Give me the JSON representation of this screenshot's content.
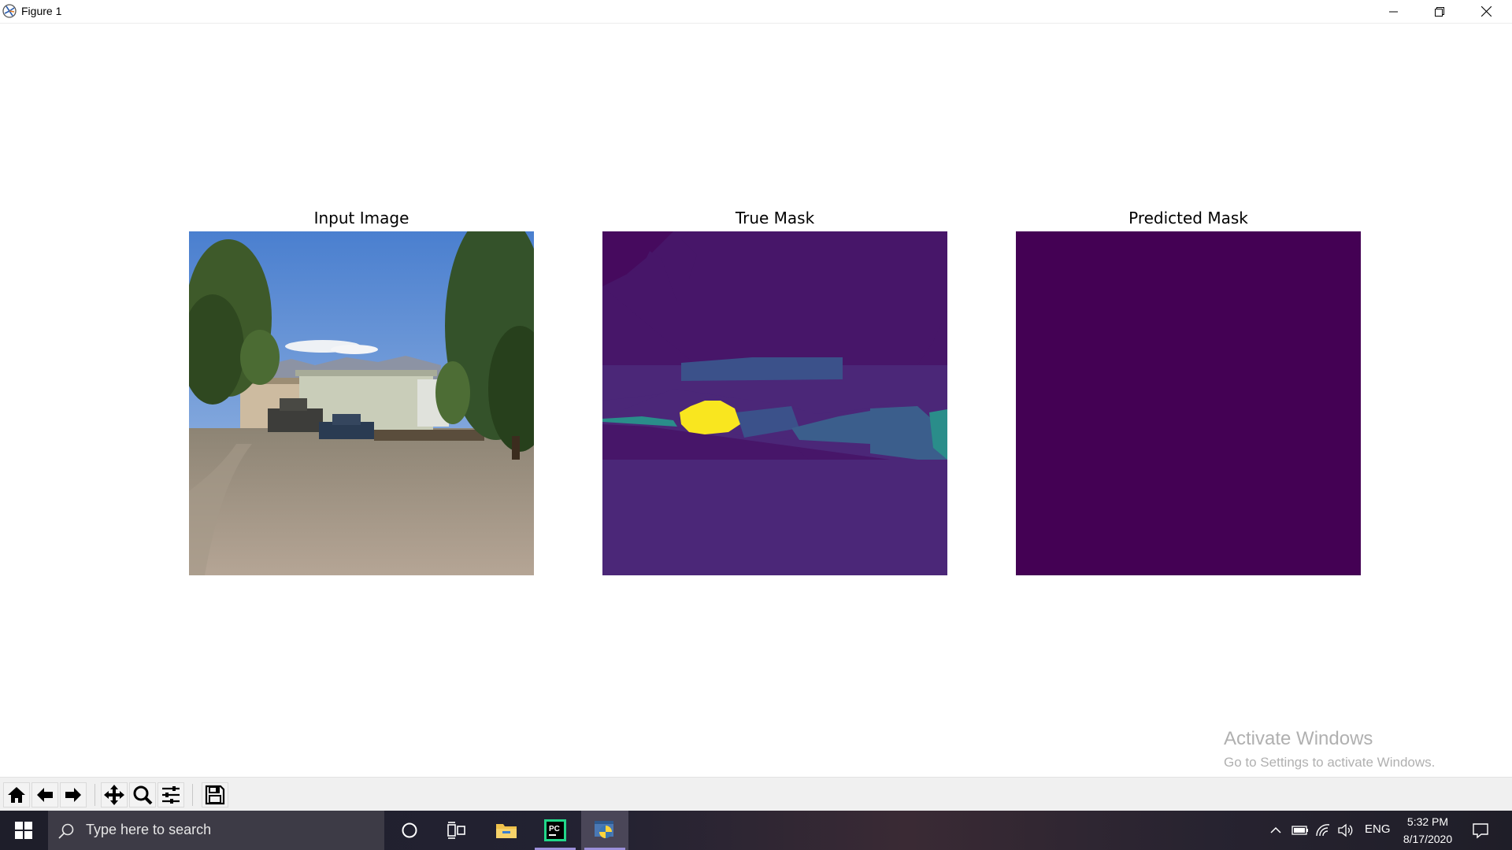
{
  "window": {
    "title": "Figure 1",
    "controls": [
      "minimize",
      "restore",
      "close"
    ]
  },
  "figure": {
    "subplots": [
      {
        "title": "Input Image",
        "content": "photo"
      },
      {
        "title": "True Mask",
        "content": "segmentation-mask"
      },
      {
        "title": "Predicted Mask",
        "content": "segmentation-mask"
      }
    ],
    "colors": {
      "mask_background": "#460a5e",
      "mask_class_1": "#471669",
      "mask_class_2": "#4b2778",
      "mask_class_3": "#3b5e8c",
      "mask_class_4": "#2a8d8a",
      "mask_class_5": "#f9e61f",
      "predicted_fill": "#440154"
    }
  },
  "watermark": {
    "title": "Activate Windows",
    "subtitle": "Go to Settings to activate Windows."
  },
  "toolbar": {
    "buttons": [
      "home-icon",
      "back-icon",
      "forward-icon",
      "pan-icon",
      "zoom-icon",
      "configure-subplots-icon",
      "save-icon"
    ]
  },
  "taskbar": {
    "search_placeholder": "Type here to search",
    "language": "ENG",
    "time": "5:32 PM",
    "date": "8/17/2020",
    "apps": [
      "cortana-icon",
      "task-view-icon",
      "file-explorer-icon",
      "pycharm-icon",
      "python-icon"
    ],
    "active_app": "python-icon"
  }
}
